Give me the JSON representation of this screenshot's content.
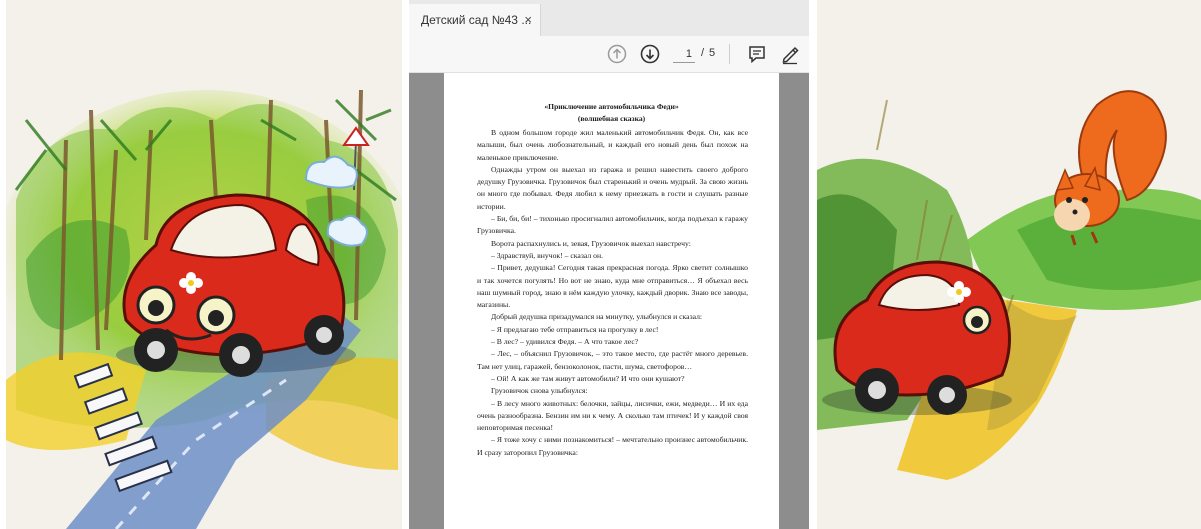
{
  "viewer": {
    "tab_title": "Детский сад №43 ...",
    "tab_close": "×",
    "toolbar": {
      "prev_icon": "arrow-up-circle-icon",
      "next_icon": "arrow-down-circle-icon",
      "current_page": "1",
      "page_separator": "/",
      "total_pages": "5",
      "comment_icon": "comment-icon",
      "draw_icon": "pen-icon"
    }
  },
  "document": {
    "title": "«Приключение автомобильчика Феди»",
    "subtitle": "(волшебная сказка)",
    "paragraphs": [
      "В одном большом городе жил маленький автомобильчик Федя. Он, как все малыши, был очень любознательный, и каждый его новый день был похож на маленькое приключение.",
      "Однажды утром он выехал из гаража и решил навестить своего доброго дедушку Грузовичка. Грузовичок был старенький и очень мудрый. За свою жизнь он много где побывал. Федя любил к нему приезжать в гости и слушать разные истории.",
      "– Би, би, би! – тихонько просигналил автомобильчик, когда подъехал к гаражу Грузовичка.",
      "Ворота распахнулись и, зевая, Грузовичок выехал навстречу:",
      "– Здравствуй, внучок! – сказал он.",
      "– Привет, дедушка! Сегодня такая прекрасная погода. Ярко светит солнышко и так хочется погулять! Но вот не знаю, куда мне отправиться… Я объехал весь наш шумный город, знаю в нём каждую улочку, каждый дворик. Знаю все заводы, магазины.",
      "Добрый дедушка призадумался на минутку, улыбнулся и сказал:",
      "– Я предлагаю тебе отправиться на прогулку в лес!",
      "– В лес? – удивился Федя. – А что такое лес?",
      "– Лес, – объяснил Грузовичок, – это такое место, где растёт много деревьев. Там нет улиц, гаражей, бензоколонок, пасти, шума, светофоров…",
      "– Ой! А как же там живут автомобили? И что они кушают?",
      "Грузовичок снова улыбнулся:",
      "– В лесу много животных: белочки, зайцы, лисички, ежи, медведи… И их еда очень разнообразна. Бензин им ни к чему. А сколько там птичек! И у каждой своя неповторимая песенка!",
      "– Я тоже хочу с ними познакомиться! – мечтательно произнес автомобильчик. И сразу заторопил Грузовичка:"
    ]
  },
  "illustrations": {
    "left_icon": "red-car-on-forest-road-drawing",
    "right_icon": "red-car-and-squirrel-drawing",
    "colors": {
      "car_red": "#d92a1c",
      "forest_green": "#6bb82a",
      "sun_yellow": "#f2c91c",
      "road_blue": "#6d8fc7",
      "squirrel_orange": "#ee6a1c"
    }
  }
}
